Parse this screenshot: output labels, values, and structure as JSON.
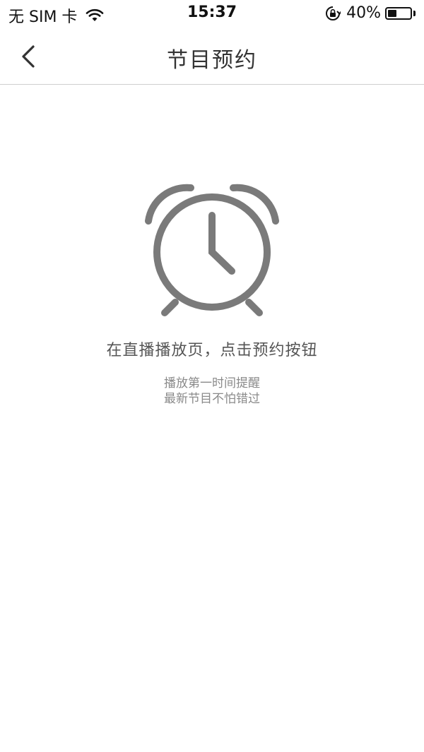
{
  "status_bar": {
    "carrier": "无 SIM 卡",
    "time": "15:37",
    "battery_percent_label": "40%",
    "battery_level": 0.4
  },
  "nav": {
    "title": "节目预约"
  },
  "empty_state": {
    "headline": "在直播播放页，点击预约按钮",
    "sub_line_1": "播放第一时间提醒",
    "sub_line_2": "最新节目不怕错过"
  },
  "colors": {
    "icon_gray": "#7a7a7a",
    "divider": "#cfcfcf",
    "title_text": "#333333"
  },
  "icons": {
    "back": "chevron-left-icon",
    "alarm": "alarm-clock-icon",
    "wifi": "wifi-icon",
    "lock": "orientation-lock-icon",
    "battery": "battery-icon"
  }
}
